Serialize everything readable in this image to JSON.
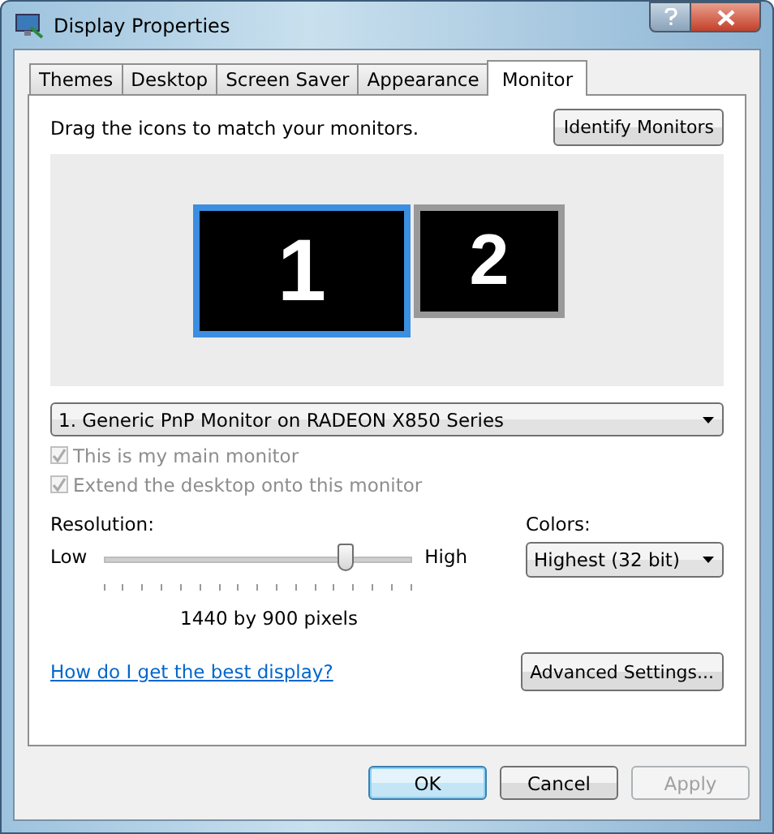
{
  "window": {
    "title": "Display Properties"
  },
  "tabs": [
    {
      "label": "Themes",
      "selected": false
    },
    {
      "label": "Desktop",
      "selected": false
    },
    {
      "label": "Screen Saver",
      "selected": false
    },
    {
      "label": "Appearance",
      "selected": false
    },
    {
      "label": "Monitor",
      "selected": true
    }
  ],
  "instruction": "Drag the icons to match your monitors.",
  "identify_button": "Identify Monitors",
  "monitors": [
    {
      "label": "1",
      "selected": true
    },
    {
      "label": "2",
      "selected": false
    }
  ],
  "monitor_dropdown": {
    "value": "1. Generic PnP Monitor on RADEON X850 Series"
  },
  "checkboxes": [
    {
      "label": "This is my main monitor",
      "checked": true,
      "disabled": true
    },
    {
      "label": "Extend the desktop onto this monitor",
      "checked": true,
      "disabled": true
    }
  ],
  "resolution": {
    "label": "Resolution:",
    "low": "Low",
    "high": "High",
    "level": 0.79,
    "reading": "1440 by 900 pixels"
  },
  "colors": {
    "label": "Colors:",
    "value": "Highest (32 bit)"
  },
  "help_link": "How do I get the best display?",
  "advanced_button": "Advanced Settings...",
  "buttons": [
    {
      "label": "OK",
      "kind": "default",
      "disabled": false
    },
    {
      "label": "Cancel",
      "kind": "normal",
      "disabled": false
    },
    {
      "label": "Apply",
      "kind": "normal",
      "disabled": true
    }
  ]
}
